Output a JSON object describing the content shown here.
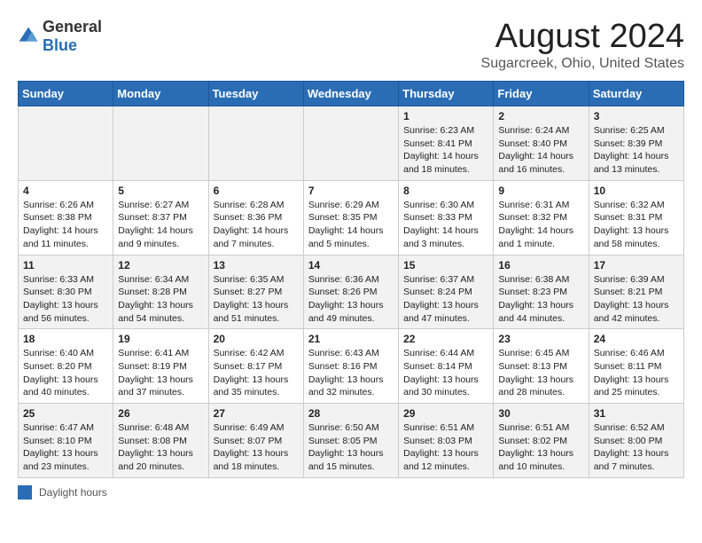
{
  "header": {
    "logo_general": "General",
    "logo_blue": "Blue",
    "month_title": "August 2024",
    "location": "Sugarcreek, Ohio, United States"
  },
  "days_of_week": [
    "Sunday",
    "Monday",
    "Tuesday",
    "Wednesday",
    "Thursday",
    "Friday",
    "Saturday"
  ],
  "weeks": [
    [
      {
        "day": "",
        "content": ""
      },
      {
        "day": "",
        "content": ""
      },
      {
        "day": "",
        "content": ""
      },
      {
        "day": "",
        "content": ""
      },
      {
        "day": "1",
        "content": "Sunrise: 6:23 AM\nSunset: 8:41 PM\nDaylight: 14 hours and 18 minutes."
      },
      {
        "day": "2",
        "content": "Sunrise: 6:24 AM\nSunset: 8:40 PM\nDaylight: 14 hours and 16 minutes."
      },
      {
        "day": "3",
        "content": "Sunrise: 6:25 AM\nSunset: 8:39 PM\nDaylight: 14 hours and 13 minutes."
      }
    ],
    [
      {
        "day": "4",
        "content": "Sunrise: 6:26 AM\nSunset: 8:38 PM\nDaylight: 14 hours and 11 minutes."
      },
      {
        "day": "5",
        "content": "Sunrise: 6:27 AM\nSunset: 8:37 PM\nDaylight: 14 hours and 9 minutes."
      },
      {
        "day": "6",
        "content": "Sunrise: 6:28 AM\nSunset: 8:36 PM\nDaylight: 14 hours and 7 minutes."
      },
      {
        "day": "7",
        "content": "Sunrise: 6:29 AM\nSunset: 8:35 PM\nDaylight: 14 hours and 5 minutes."
      },
      {
        "day": "8",
        "content": "Sunrise: 6:30 AM\nSunset: 8:33 PM\nDaylight: 14 hours and 3 minutes."
      },
      {
        "day": "9",
        "content": "Sunrise: 6:31 AM\nSunset: 8:32 PM\nDaylight: 14 hours and 1 minute."
      },
      {
        "day": "10",
        "content": "Sunrise: 6:32 AM\nSunset: 8:31 PM\nDaylight: 13 hours and 58 minutes."
      }
    ],
    [
      {
        "day": "11",
        "content": "Sunrise: 6:33 AM\nSunset: 8:30 PM\nDaylight: 13 hours and 56 minutes."
      },
      {
        "day": "12",
        "content": "Sunrise: 6:34 AM\nSunset: 8:28 PM\nDaylight: 13 hours and 54 minutes."
      },
      {
        "day": "13",
        "content": "Sunrise: 6:35 AM\nSunset: 8:27 PM\nDaylight: 13 hours and 51 minutes."
      },
      {
        "day": "14",
        "content": "Sunrise: 6:36 AM\nSunset: 8:26 PM\nDaylight: 13 hours and 49 minutes."
      },
      {
        "day": "15",
        "content": "Sunrise: 6:37 AM\nSunset: 8:24 PM\nDaylight: 13 hours and 47 minutes."
      },
      {
        "day": "16",
        "content": "Sunrise: 6:38 AM\nSunset: 8:23 PM\nDaylight: 13 hours and 44 minutes."
      },
      {
        "day": "17",
        "content": "Sunrise: 6:39 AM\nSunset: 8:21 PM\nDaylight: 13 hours and 42 minutes."
      }
    ],
    [
      {
        "day": "18",
        "content": "Sunrise: 6:40 AM\nSunset: 8:20 PM\nDaylight: 13 hours and 40 minutes."
      },
      {
        "day": "19",
        "content": "Sunrise: 6:41 AM\nSunset: 8:19 PM\nDaylight: 13 hours and 37 minutes."
      },
      {
        "day": "20",
        "content": "Sunrise: 6:42 AM\nSunset: 8:17 PM\nDaylight: 13 hours and 35 minutes."
      },
      {
        "day": "21",
        "content": "Sunrise: 6:43 AM\nSunset: 8:16 PM\nDaylight: 13 hours and 32 minutes."
      },
      {
        "day": "22",
        "content": "Sunrise: 6:44 AM\nSunset: 8:14 PM\nDaylight: 13 hours and 30 minutes."
      },
      {
        "day": "23",
        "content": "Sunrise: 6:45 AM\nSunset: 8:13 PM\nDaylight: 13 hours and 28 minutes."
      },
      {
        "day": "24",
        "content": "Sunrise: 6:46 AM\nSunset: 8:11 PM\nDaylight: 13 hours and 25 minutes."
      }
    ],
    [
      {
        "day": "25",
        "content": "Sunrise: 6:47 AM\nSunset: 8:10 PM\nDaylight: 13 hours and 23 minutes."
      },
      {
        "day": "26",
        "content": "Sunrise: 6:48 AM\nSunset: 8:08 PM\nDaylight: 13 hours and 20 minutes."
      },
      {
        "day": "27",
        "content": "Sunrise: 6:49 AM\nSunset: 8:07 PM\nDaylight: 13 hours and 18 minutes."
      },
      {
        "day": "28",
        "content": "Sunrise: 6:50 AM\nSunset: 8:05 PM\nDaylight: 13 hours and 15 minutes."
      },
      {
        "day": "29",
        "content": "Sunrise: 6:51 AM\nSunset: 8:03 PM\nDaylight: 13 hours and 12 minutes."
      },
      {
        "day": "30",
        "content": "Sunrise: 6:51 AM\nSunset: 8:02 PM\nDaylight: 13 hours and 10 minutes."
      },
      {
        "day": "31",
        "content": "Sunrise: 6:52 AM\nSunset: 8:00 PM\nDaylight: 13 hours and 7 minutes."
      }
    ]
  ],
  "legend": {
    "box_label": "Daylight hours"
  }
}
